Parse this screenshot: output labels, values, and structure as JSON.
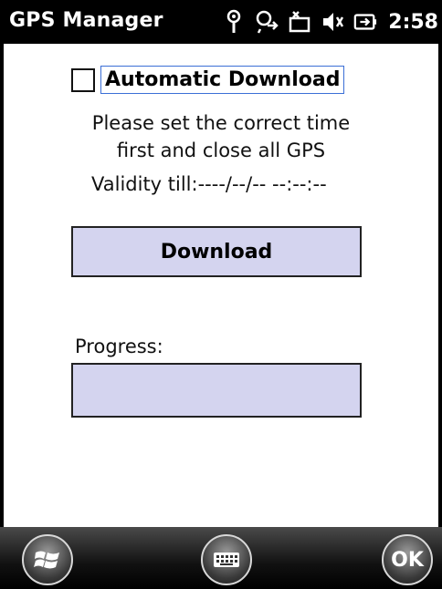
{
  "titlebar": {
    "title": "GPS Manager",
    "time": "2:58"
  },
  "status_icons": [
    "antenna-icon",
    "connectivity-icon",
    "messaging-icon",
    "speaker-icon",
    "battery-icon"
  ],
  "form": {
    "auto_download_label": "Automatic Download",
    "auto_download_checked": false,
    "info_line1": "Please set the correct time",
    "info_line2": "first and close all GPS",
    "validity": "Validity till:----/--/-- --:--:--",
    "download_label": "Download",
    "progress_label": "Progress:",
    "progress_value": 0
  },
  "softkeys": {
    "ok_label": "OK"
  },
  "colors": {
    "button_fill": "#d4d4ef",
    "focus_border": "#3b6fd6"
  }
}
